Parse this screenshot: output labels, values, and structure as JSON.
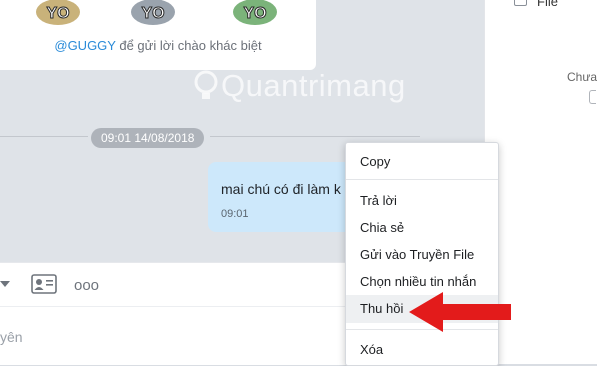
{
  "stickers": {
    "label": "YO"
  },
  "guggy": {
    "mention": "@GUGGY",
    "text": " để gửi lời chào khác biệt"
  },
  "timeline": {
    "date": "09:01 14/08/2018"
  },
  "message": {
    "text": "mai chú có đi làm k",
    "time": "09:01"
  },
  "toolbar": {
    "more": "ooo"
  },
  "input": {
    "placeholder": "yên"
  },
  "watermark": {
    "text": "Quantrimang"
  },
  "right_panel": {
    "file_label": "File",
    "status": "Chưa"
  },
  "context_menu": {
    "items": [
      "Copy",
      "Trả lời",
      "Chia sẻ",
      "Gửi vào Truyền File",
      "Chọn nhiều tin nhắn",
      "Thu hồi",
      "Xóa"
    ],
    "highlighted": "Thu hồi"
  },
  "colors": {
    "bubble": "#cde8fb",
    "link": "#2a8bd8",
    "arrow": "#e31b1b"
  }
}
